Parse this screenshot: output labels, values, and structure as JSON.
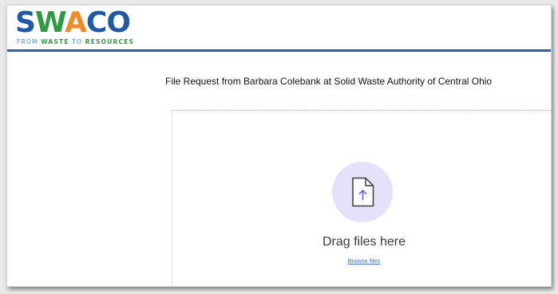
{
  "logo": {
    "prefix": "S",
    "w": "W",
    "a": "A",
    "suffix": "CO",
    "tagline_from": "FROM",
    "tagline_waste": "WASTE",
    "tagline_to": "TO",
    "tagline_resources": "RESOURCES"
  },
  "request": {
    "title": "File Request from Barbara Colebank at Solid Waste Authority of Central Ohio"
  },
  "upload": {
    "drag_label": "Drag files here",
    "browse_label": "Browse files",
    "icon": "file-upload-icon"
  },
  "colors": {
    "brand_blue": "#1e5aa8",
    "brand_green": "#2f9a43",
    "brand_orange": "#f08a24",
    "accent_purple_light": "#e4e2fb",
    "accent_purple": "#6c63d9",
    "link": "#3b6ad4"
  }
}
